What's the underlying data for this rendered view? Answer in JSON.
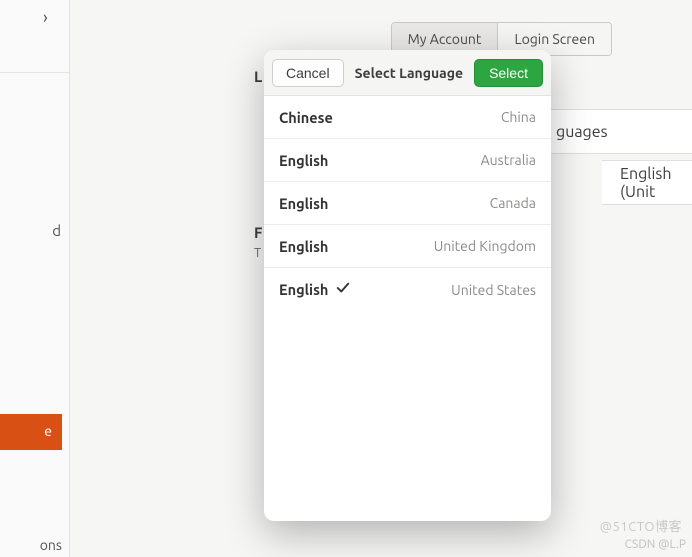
{
  "sidebar": {
    "partial_d": "d",
    "highlight_text": "e",
    "bottom_text": "ons"
  },
  "tabs": {
    "my_account": "My Account",
    "login_screen": "Login Screen"
  },
  "background": {
    "label_L": "L",
    "label_F": "F",
    "label_T": "T",
    "row_languages": "guages",
    "row_english_united": "English (Unit"
  },
  "modal": {
    "cancel": "Cancel",
    "title": "Select Language",
    "select": "Select",
    "items": [
      {
        "name": "Chinese",
        "region": "China",
        "selected": false
      },
      {
        "name": "English",
        "region": "Australia",
        "selected": false
      },
      {
        "name": "English",
        "region": "Canada",
        "selected": false
      },
      {
        "name": "English",
        "region": "United Kingdom",
        "selected": false
      },
      {
        "name": "English",
        "region": "United States",
        "selected": true
      }
    ]
  },
  "watermark": {
    "line1": "@51CTO博客",
    "line2": "CSDN @L.P"
  }
}
